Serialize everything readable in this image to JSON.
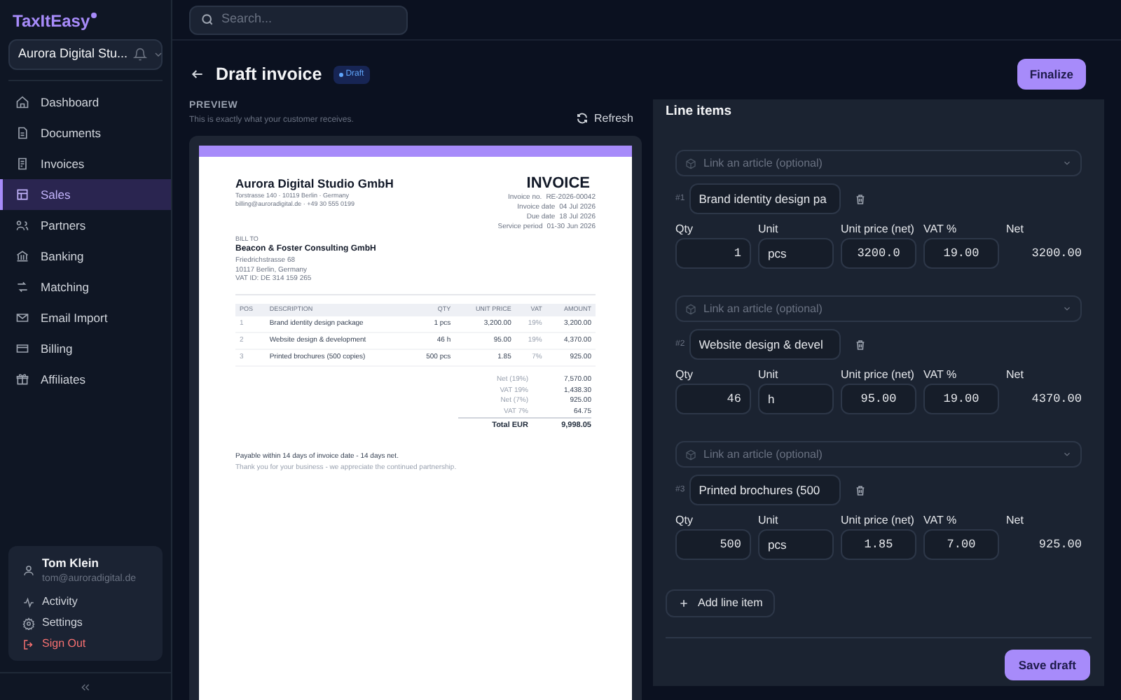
{
  "app": {
    "logo": "TaxItEasy",
    "org": "Aurora Digital Stu...",
    "nav": [
      {
        "label": "Dashboard",
        "selected": false
      },
      {
        "label": "Documents",
        "selected": false
      },
      {
        "label": "Invoices",
        "selected": false
      },
      {
        "label": "Sales",
        "selected": true
      },
      {
        "label": "Partners",
        "selected": false
      },
      {
        "label": "Banking",
        "selected": false
      },
      {
        "label": "Matching",
        "selected": false
      },
      {
        "label": "Email Import",
        "selected": false
      },
      {
        "label": "Billing",
        "selected": false
      },
      {
        "label": "Affiliates",
        "selected": false
      }
    ],
    "user": {
      "name": "Tom Klein",
      "email": "tom@auroradigital.de"
    },
    "user_menu": [
      {
        "label": "Activity",
        "kind": "normal"
      },
      {
        "label": "Settings",
        "kind": "normal"
      },
      {
        "label": "Sign Out",
        "kind": "danger"
      }
    ]
  },
  "search": {
    "placeholder": "Search..."
  },
  "header": {
    "title": "Draft invoice",
    "badge": "Draft",
    "action": "Finalize"
  },
  "preview": {
    "heading": "PREVIEW",
    "subtitle": "This is exactly what your customer receives.",
    "refresh": "Refresh",
    "invoice": {
      "seller": "Aurora Digital Studio GmbH",
      "seller_lines": [
        "Torstrasse 140 · 10119 Berlin · Germany",
        "billing@auroradigital.de · +49 30 555 0199"
      ],
      "title": "INVOICE",
      "meta": [
        {
          "label": "Invoice no.",
          "value": "RE-2026-00042"
        },
        {
          "label": "Invoice date",
          "value": "04 Jul 2026"
        },
        {
          "label": "Due date",
          "value": "18 Jul 2026"
        },
        {
          "label": "Service period",
          "value": "01-30 Jun 2026"
        }
      ],
      "bill_to_label": "BILL TO",
      "client": "Beacon & Foster Consulting GmbH",
      "client_lines": [
        "Friedrichstrasse 68",
        "10117 Berlin, Germany",
        "VAT ID: DE 314 159 265"
      ],
      "columns": [
        "POS",
        "DESCRIPTION",
        "QTY",
        "UNIT PRICE",
        "VAT",
        "AMOUNT"
      ],
      "rows": [
        [
          "1",
          "Brand identity design package",
          "1 pcs",
          "3,200.00",
          "19%",
          "3,200.00"
        ],
        [
          "2",
          "Website design & development",
          "46 h",
          "95.00",
          "19%",
          "4,370.00"
        ],
        [
          "3",
          "Printed brochures (500 copies)",
          "500 pcs",
          "1.85",
          "7%",
          "925.00"
        ]
      ],
      "totals": [
        {
          "label": "Net (19%)",
          "value": "7,570.00",
          "kind": "sub"
        },
        {
          "label": "VAT 19%",
          "value": "1,438.30",
          "kind": "sub"
        },
        {
          "label": "Net (7%)",
          "value": "925.00",
          "kind": "sub"
        },
        {
          "label": "VAT 7%",
          "value": "64.75",
          "kind": "sub"
        },
        {
          "label": "Total EUR",
          "value": "9,998.05",
          "kind": "total"
        }
      ],
      "footer": [
        "Payable within 14 days of invoice date - 14 days net.",
        "Thank you for your business - we appreciate the continued partnership."
      ]
    }
  },
  "line_items": {
    "title": "Line items",
    "items": [
      {
        "article_placeholder": "Link an article (optional)",
        "number": "#1",
        "description": "Brand identity design pa",
        "labels": [
          "Qty",
          "Unit",
          "Unit price (net)",
          "VAT %",
          "Net"
        ],
        "qty": "1",
        "unit": "pcs",
        "price": "3200.0",
        "vat": "19.00",
        "net": "3200.00"
      },
      {
        "article_placeholder": "Link an article (optional)",
        "number": "#2",
        "description": "Website design & devel",
        "labels": [
          "Qty",
          "Unit",
          "Unit price (net)",
          "VAT %",
          "Net"
        ],
        "qty": "46",
        "unit": "h",
        "price": "95.00",
        "vat": "19.00",
        "net": "4370.00"
      },
      {
        "article_placeholder": "Link an article (optional)",
        "number": "#3",
        "description": "Printed brochures (500",
        "labels": [
          "Qty",
          "Unit",
          "Unit price (net)",
          "VAT %",
          "Net"
        ],
        "qty": "500",
        "unit": "pcs",
        "price": "1.85",
        "vat": "7.00",
        "net": "925.00"
      }
    ],
    "add": "Add line item",
    "save": "Save draft"
  }
}
